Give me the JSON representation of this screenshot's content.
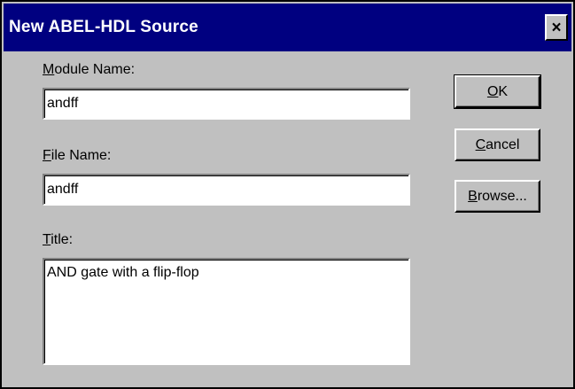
{
  "window": {
    "title": "New ABEL-HDL Source",
    "close_glyph": "×"
  },
  "form": {
    "module_name": {
      "mnemonic": "M",
      "label_rest": "odule Name:",
      "value": "andff"
    },
    "file_name": {
      "mnemonic": "F",
      "label_rest": "ile Name:",
      "value": "andff"
    },
    "title": {
      "mnemonic": "T",
      "label_rest": "itle:",
      "value": "AND gate with a flip-flop"
    }
  },
  "buttons": {
    "ok": {
      "mnemonic": "O",
      "rest": "K"
    },
    "cancel": {
      "mnemonic": "C",
      "rest": "ancel"
    },
    "browse": {
      "mnemonic": "B",
      "rest": "rowse..."
    }
  },
  "colors": {
    "titlebar": "#000080",
    "face": "#c0c0c0",
    "field": "#ffffff"
  },
  "icons": {
    "close": "close-icon"
  }
}
